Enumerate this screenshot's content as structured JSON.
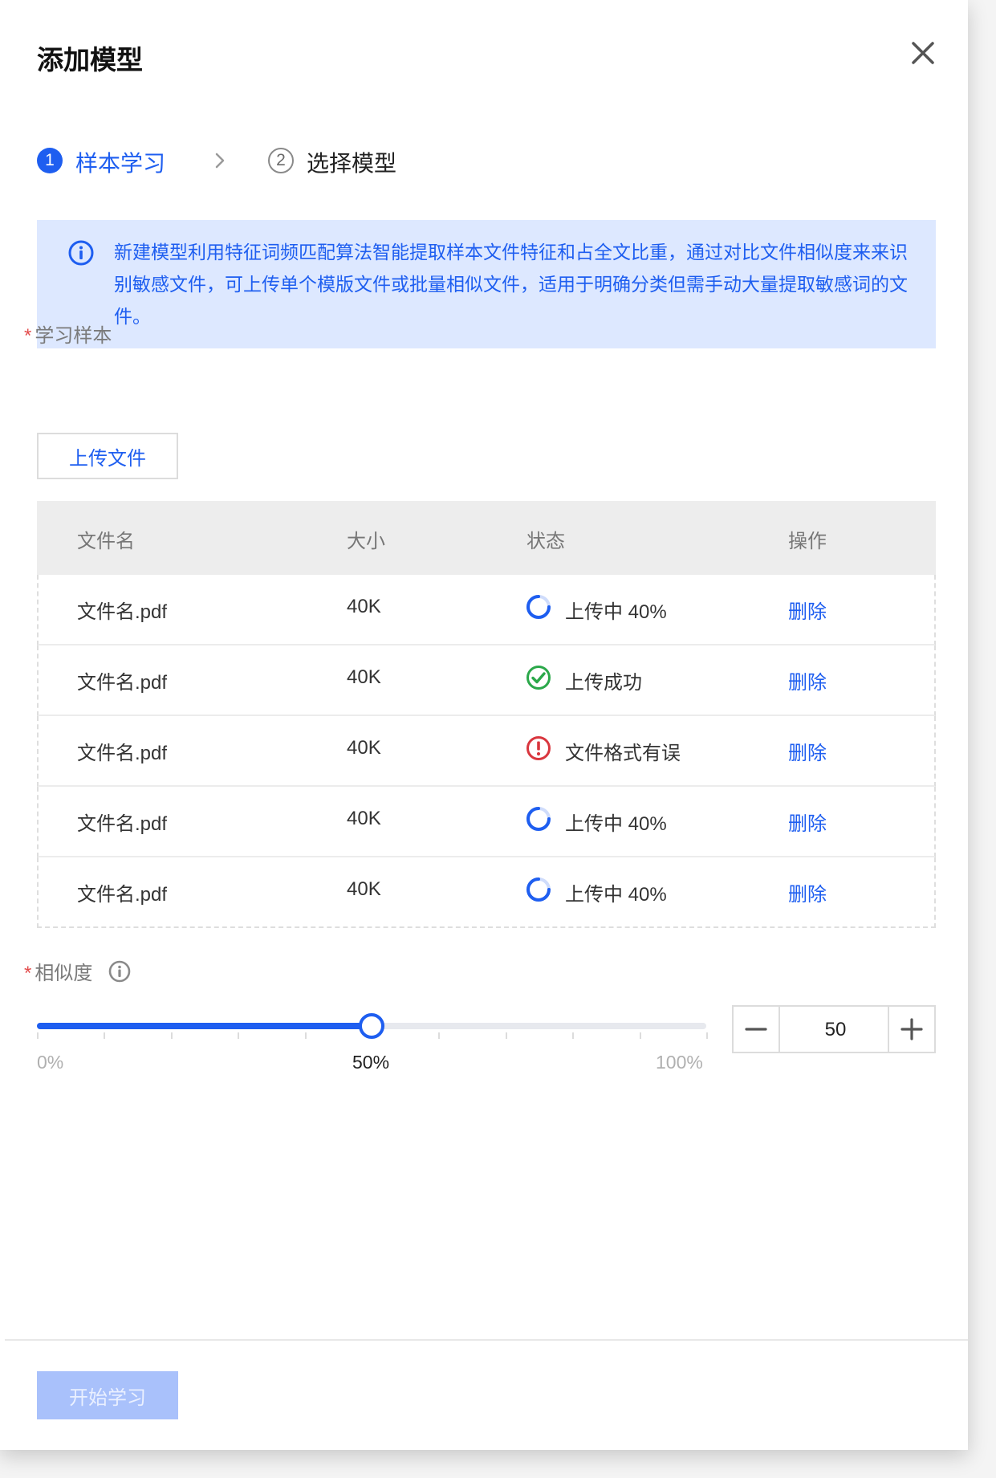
{
  "dialog": {
    "title": "添加模型",
    "close_icon": "close-icon"
  },
  "steps": [
    {
      "number": "1",
      "label": "样本学习",
      "state": "active"
    },
    {
      "number": "2",
      "label": "选择模型",
      "state": "inactive"
    }
  ],
  "alert": {
    "icon": "info-icon",
    "text": "新建模型利用特征词频匹配算法智能提取样本文件特征和占全文比重，通过对比文件相似度来来识别敏感文件，可上传单个模版文件或批量相似文件，适用于明确分类但需手动大量提取敏感词的文件。"
  },
  "sample_field": {
    "required_mark": "*",
    "label": "学习样本",
    "upload_button": "上传文件"
  },
  "table": {
    "headers": [
      "文件名",
      "大小",
      "状态",
      "操作"
    ],
    "rows": [
      {
        "name": "文件名.pdf",
        "size": "40K",
        "status": "上传中 40%",
        "status_icon": "loading-icon",
        "action": "删除"
      },
      {
        "name": "文件名.pdf",
        "size": "40K",
        "status": "上传成功",
        "status_icon": "success-check-icon",
        "action": "删除"
      },
      {
        "name": "文件名.pdf",
        "size": "40K",
        "status": "文件格式有误",
        "status_icon": "error-icon",
        "action": "删除"
      },
      {
        "name": "文件名.pdf",
        "size": "40K",
        "status": "上传中 40%",
        "status_icon": "loading-icon",
        "action": "删除"
      },
      {
        "name": "文件名.pdf",
        "size": "40K",
        "status": "上传中 40%",
        "status_icon": "loading-icon",
        "action": "删除"
      }
    ]
  },
  "similarity": {
    "required_mark": "*",
    "label": "相似度",
    "info_icon": "info-icon",
    "slider": {
      "value": 50,
      "min_label": "0%",
      "current_label": "50%",
      "max_label": "100%"
    },
    "stepper_value": "50",
    "minus_icon": "minus-icon",
    "plus_icon": "plus-icon"
  },
  "footer": {
    "start_button": "开始学习"
  },
  "colors": {
    "primary": "#1e5ef0",
    "alert_bg": "#dde8ff",
    "success": "#2ba84a",
    "error": "#d9363e",
    "required": "#e34d4d",
    "disabled_button": "#a9c1fb"
  }
}
